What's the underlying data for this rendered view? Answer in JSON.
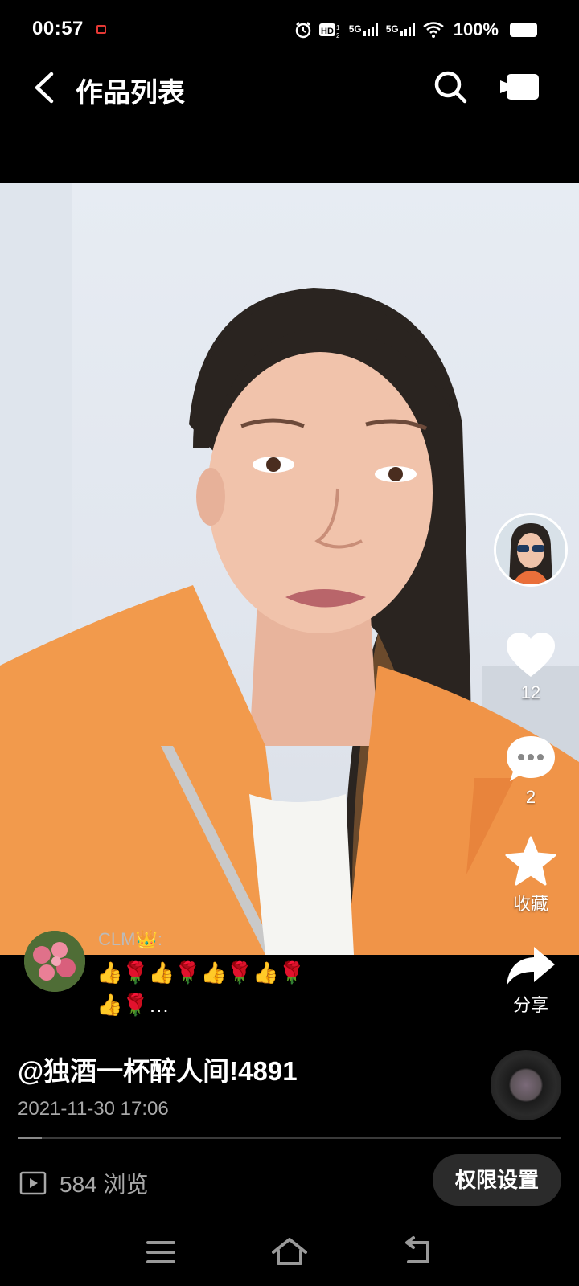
{
  "status_bar": {
    "time": "00:57",
    "icons": [
      "recording-icon",
      "alarm-icon",
      "hd-icon",
      "signal-5g-icon",
      "signal-5g-icon",
      "wifi-icon"
    ],
    "network_label": "5G",
    "battery_text": "100%"
  },
  "header": {
    "title": "作品列表",
    "icons": [
      "back-icon",
      "search-icon",
      "camera-icon"
    ]
  },
  "sidebar": {
    "like_count": "12",
    "comment_count": "2",
    "favorite_label": "收藏",
    "share_label": "分享"
  },
  "comment": {
    "user": "CLM👑:",
    "text": "👍🌹👍🌹👍🌹👍🌹👍🌹…"
  },
  "video_info": {
    "handle": "@独酒一杯醉人间!4891",
    "date": "2021-11-30 17:06",
    "progress": 0.045
  },
  "footer": {
    "views": "584 浏览",
    "permission_button": "权限设置"
  },
  "colors": {
    "background": "#000000",
    "video_wall": "#e4e9f0",
    "jacket": "#f29a4c",
    "muted_text": "#a8a8a8",
    "button_bg": "#2b2b2b"
  }
}
